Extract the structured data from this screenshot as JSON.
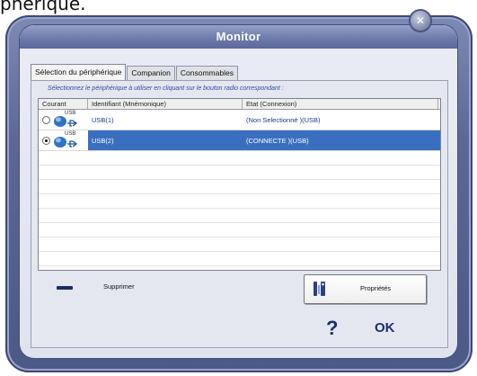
{
  "caption": "phérique.",
  "window": {
    "title": "Monitor",
    "close_glyph": "✕"
  },
  "tabs": [
    {
      "label": "Sélection du périphérique",
      "active": true
    },
    {
      "label": "Companion",
      "active": false
    },
    {
      "label": "Consommables",
      "active": false
    }
  ],
  "instructions": "Sélectionnez le périphérique à utiliser en cliquant sur le bouton radio correspondant :",
  "table": {
    "columns": [
      "Courant",
      "Identifiant (Mnémonique)",
      "Etat (Connexion)"
    ],
    "rows": [
      {
        "usb_label": "USB",
        "identifier": "USB(1)",
        "state": "(Non Selectionné )(USB)",
        "selected": false,
        "radio_checked": false
      },
      {
        "usb_label": "USB",
        "identifier": "USB(2)",
        "state": "(CONNECTE )(USB)",
        "selected": true,
        "radio_checked": true
      }
    ]
  },
  "actions": {
    "delete_label": "Supprimer",
    "properties_label": "Propriétés",
    "help_label": "?",
    "ok_label": "OK"
  },
  "icons": {
    "close": "close-icon",
    "usb_device": "usb-device-icon",
    "delete": "minus-icon",
    "properties": "wrench-icon"
  },
  "colors": {
    "frame": "#5b6897",
    "selection": "#3a6fc0",
    "accent_text": "#1a2e75"
  }
}
